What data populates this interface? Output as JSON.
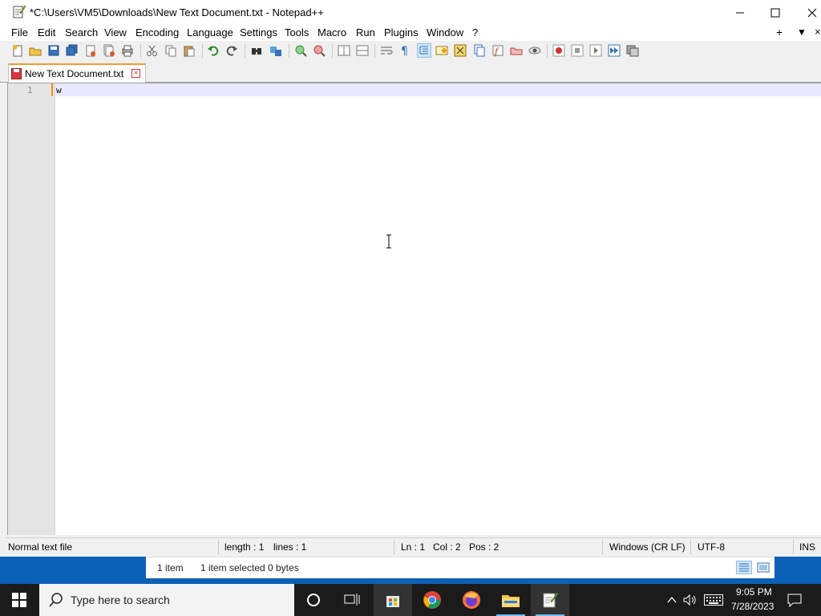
{
  "window": {
    "title": "*C:\\Users\\VM5\\Downloads\\New Text Document.txt - Notepad++"
  },
  "menu": {
    "items": [
      "File",
      "Edit",
      "Search",
      "View",
      "Encoding",
      "Language",
      "Settings",
      "Tools",
      "Macro",
      "Run",
      "Plugins",
      "Window",
      "?"
    ],
    "right_plus": "+",
    "right_down": "▼",
    "right_close": "×"
  },
  "tab": {
    "label": "New Text Document.txt",
    "close": "×"
  },
  "editor": {
    "line_number": "1",
    "line_text": "w"
  },
  "statusbar": {
    "file_type": "Normal text file",
    "length": "length : 1",
    "lines": "lines : 1",
    "ln": "Ln : 1",
    "col": "Col : 2",
    "pos": "Pos : 2",
    "eol": "Windows (CR LF)",
    "encoding": "UTF-8",
    "mode": "INS"
  },
  "explorer_status": {
    "count": "1 item",
    "selected": "1 item selected",
    "size": "0 bytes"
  },
  "taskbar": {
    "search_placeholder": "Type here to search",
    "time": "9:05 PM",
    "date": "7/28/2023"
  },
  "colors": {
    "tab_accent": "#fa9a26",
    "current_line": "#e8e8ff",
    "taskbar": "#1b1b1b"
  }
}
